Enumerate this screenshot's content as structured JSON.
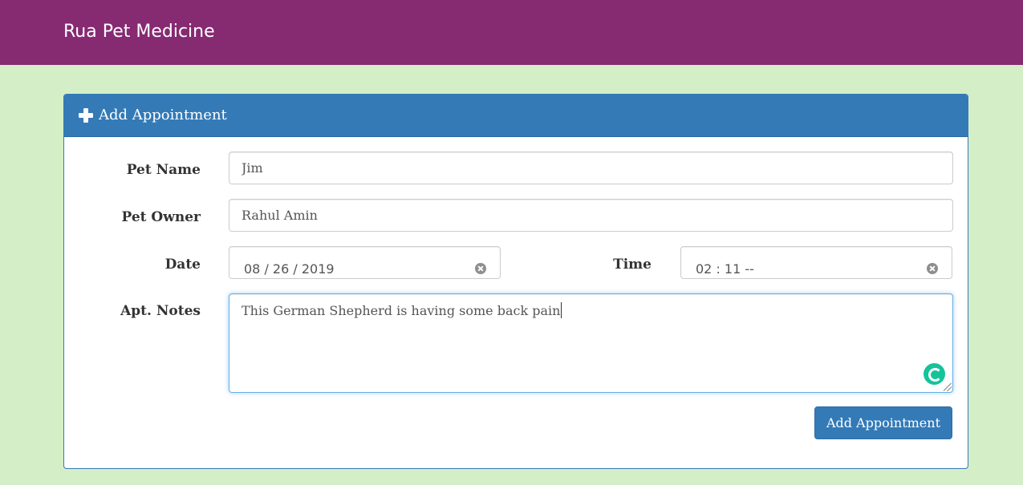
{
  "navbar": {
    "brand": "Rua Pet Medicine"
  },
  "panel": {
    "title": "Add Appointment",
    "icon": "plus-icon"
  },
  "form": {
    "pet_name": {
      "label": "Pet Name",
      "value": "Jim"
    },
    "pet_owner": {
      "label": "Pet Owner",
      "value": "Rahul Amin"
    },
    "date": {
      "label": "Date",
      "value": "08 / 26 / 2019"
    },
    "time": {
      "label": "Time",
      "value": "02 : 11   --"
    },
    "notes": {
      "label": "Apt. Notes",
      "value": "This German Shepherd is having some back pain"
    },
    "submit_label": "Add Appointment"
  },
  "colors": {
    "navbar": "#862a72",
    "background": "#d4efc8",
    "primary": "#337ab7",
    "grammarly": "#15c39a"
  }
}
